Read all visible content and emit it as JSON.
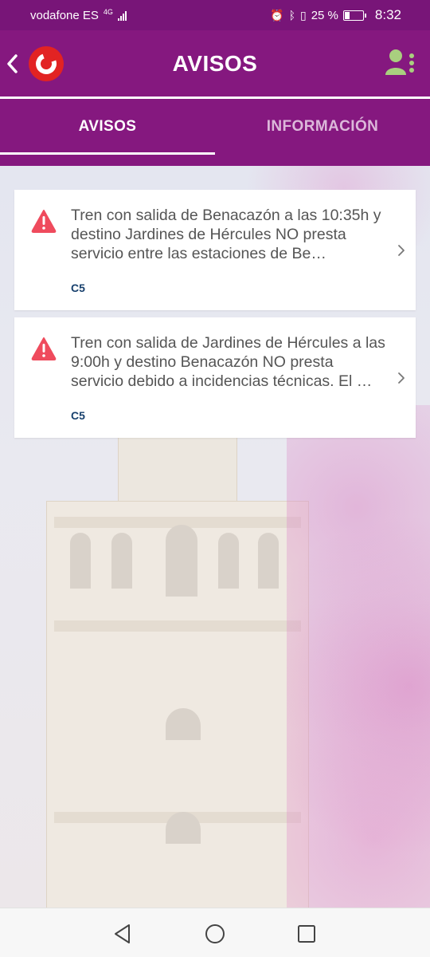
{
  "status_bar": {
    "carrier": "vodafone ES",
    "network": "4G",
    "battery": "25 %",
    "time": "8:32"
  },
  "header": {
    "title": "AVISOS"
  },
  "tabs": [
    {
      "label": "AVISOS",
      "active": true
    },
    {
      "label": "INFORMACIÓN",
      "active": false
    }
  ],
  "alerts": [
    {
      "text": "Tren con salida de Benacazón a las 10:35h y destino Jardines de Hércules NO presta servicio entre las estaciones de Be…",
      "line": "C5"
    },
    {
      "text": "Tren con salida de Jardines de Hércules a las 9:00h y destino Benacazón NO presta servicio debido a incidencias técnicas. El …",
      "line": "C5"
    }
  ],
  "colors": {
    "header_bg": "#85187f",
    "status_bg": "#781578",
    "alert_icon": "#ef4b5d",
    "line_label": "#17406d",
    "logo_red": "#e22323",
    "user_icon": "#a9cf7f"
  },
  "icons": {
    "back": "chevron-left-icon",
    "logo": "renfe-cercanias-logo",
    "user": "user-menu-icon",
    "alert": "warning-triangle-icon",
    "chevron": "chevron-right-icon"
  }
}
